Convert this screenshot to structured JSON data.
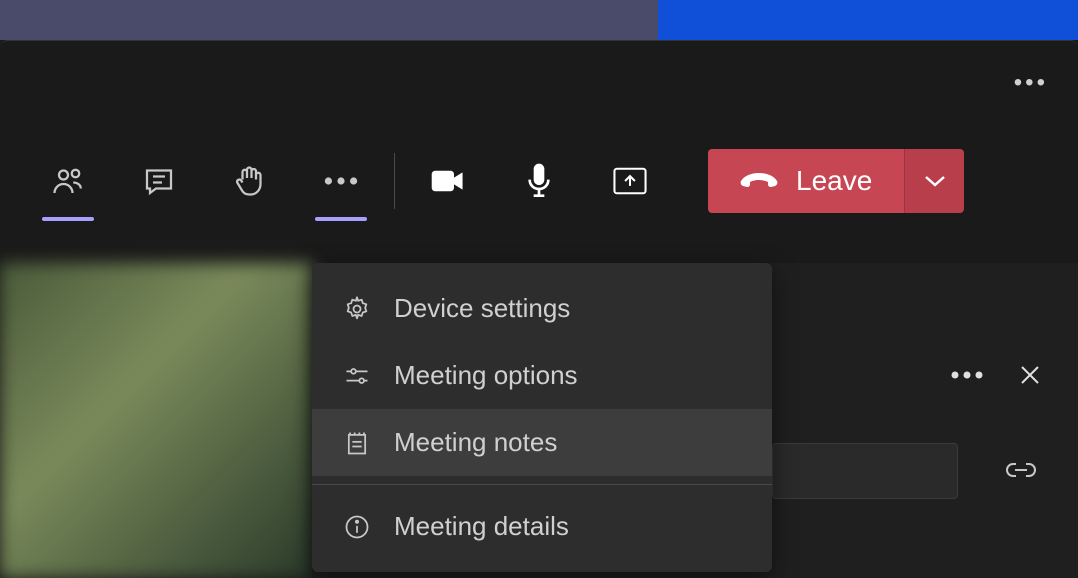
{
  "toolbar": {
    "people_icon": "people",
    "chat_icon": "chat",
    "raise_hand_icon": "raise-hand",
    "more_icon": "more-options",
    "camera_icon": "camera",
    "mic_icon": "microphone",
    "share_icon": "share-screen",
    "leave_label": "Leave"
  },
  "menu": {
    "items": [
      {
        "icon": "device-settings",
        "label": "Device settings"
      },
      {
        "icon": "meeting-options",
        "label": "Meeting options"
      },
      {
        "icon": "meeting-notes",
        "label": "Meeting notes"
      },
      {
        "icon": "meeting-details",
        "label": "Meeting details"
      }
    ]
  },
  "panel": {
    "more_icon": "more",
    "close_icon": "close",
    "link_icon": "link"
  }
}
